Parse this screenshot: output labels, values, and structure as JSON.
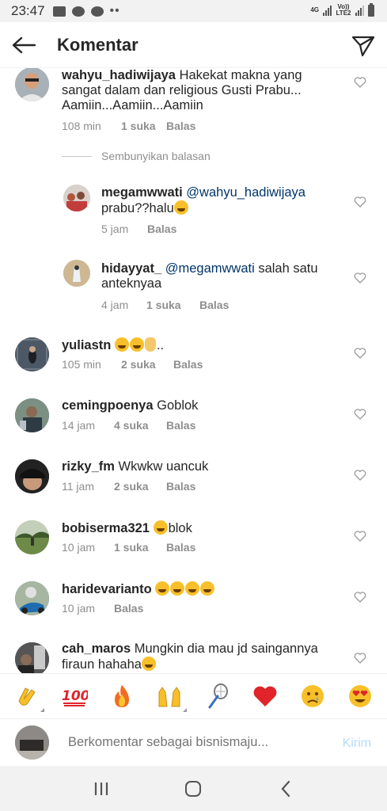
{
  "status_bar": {
    "time": "23:47",
    "network_1": "4G",
    "network_2": "Vo)) LTE2"
  },
  "header": {
    "title": "Komentar"
  },
  "comments": [
    {
      "username": "wahyu_hadiwijaya",
      "text": "Hakekat makna yang sangat dalam dan religious Gusti Prabu... Aamiin...Aamiin...Aamiin",
      "time": "108 min",
      "likes": "1 suka",
      "reply": "Balas"
    },
    {
      "username": "yuliastn",
      "text": "..",
      "time": "105 min",
      "likes": "2 suka",
      "reply": "Balas"
    },
    {
      "username": "cemingpoenya",
      "text": "Goblok",
      "time": "14 jam",
      "likes": "4 suka",
      "reply": "Balas"
    },
    {
      "username": "rizky_fm",
      "text": "Wkwkw uancuk",
      "time": "11 jam",
      "likes": "2 suka",
      "reply": "Balas"
    },
    {
      "username": "bobiserma321",
      "text": "blok",
      "time": "10 jam",
      "likes": "1 suka",
      "reply": "Balas"
    },
    {
      "username": "haridevarianto",
      "text": "",
      "time": "10 jam",
      "reply": "Balas"
    },
    {
      "username": "cah_maros",
      "text": "Mungkin dia mau jd saingannya firaun hahaha"
    }
  ],
  "hide_replies_label": "Sembunyikan balasan",
  "replies": [
    {
      "username": "megamwwati",
      "mention": "@wahyu_hadiwijaya",
      "text": "prabu??halu",
      "time": "5 jam",
      "reply": "Balas"
    },
    {
      "username": "hidayyat_",
      "mention": "@megamwwati",
      "text": "salah satu anteknyaa",
      "time": "4 jam",
      "likes": "1 suka",
      "reply": "Balas"
    }
  ],
  "emoji_bar": [
    "clapping-hands",
    "hundred-points",
    "fire",
    "raising-hands",
    "badminton",
    "red-heart",
    "crying-face",
    "heart-eyes"
  ],
  "compose": {
    "placeholder": "Berkomentar sebagai bisnismaju...",
    "send_label": "Kirim"
  },
  "colors": {
    "mention": "#003569",
    "meta": "#8e8e8e",
    "send_disabled": "#b3dbff",
    "text": "#262626"
  }
}
